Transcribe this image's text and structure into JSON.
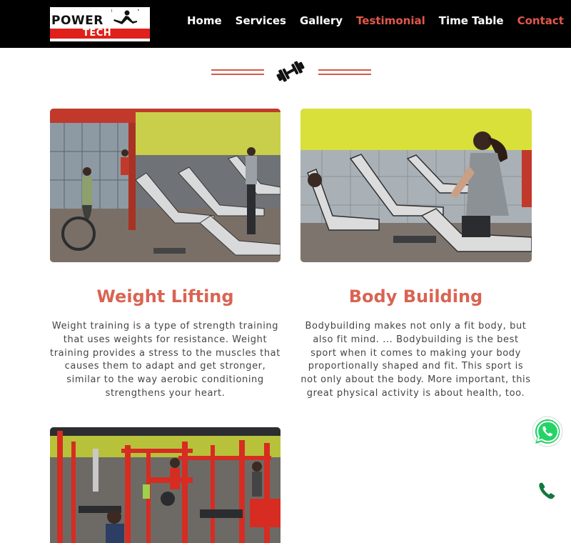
{
  "brand": {
    "word1": "POWER",
    "word2": "TECH",
    "colors": {
      "red": "#e0201a",
      "accent": "#d96453"
    }
  },
  "nav": {
    "items": [
      {
        "label": "Home"
      },
      {
        "label": "Services"
      },
      {
        "label": "Gallery"
      },
      {
        "label": "Testimonial"
      },
      {
        "label": "Time Table"
      },
      {
        "label": "Contact"
      }
    ]
  },
  "divider": {
    "icon": "dumbbell-icon"
  },
  "services": [
    {
      "title": "Weight Lifting",
      "description": "Weight training is a type of strength training that uses weights for resistance. Weight training provides a stress to the muscles that causes them to adapt and get stronger, similar to the way aerobic conditioning strengthens your heart.",
      "image": "gym-treadmills-photo"
    },
    {
      "title": "Body Building",
      "description": "Bodybuilding makes not only a fit body, but also fit mind. ... Bodybuilding is the best sport when it comes to making your body proportionally shaped and fit. This sport is not only about the body. More important, this great physical activity is about health, too.",
      "image": "woman-treadmill-photo"
    },
    {
      "image": "gym-equipment-photo"
    }
  ],
  "floating": {
    "whatsapp_icon": "whatsapp-icon",
    "phone_icon": "phone-icon",
    "whatsapp_color": "#25d366",
    "phone_color": "#0f7a3c"
  }
}
